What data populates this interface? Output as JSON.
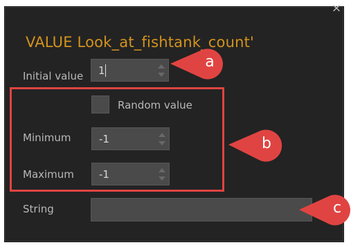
{
  "dialog": {
    "title": "VALUE Look_at_fishtank_count'",
    "close_glyph": "×"
  },
  "fields": {
    "initial_value_label": "Initial value",
    "initial_value": "1",
    "random_value_label": "Random value",
    "random_value_checked": false,
    "minimum_label": "Minimum",
    "minimum_value": "-1",
    "maximum_label": "Maximum",
    "maximum_value": "-1",
    "string_label": "String",
    "string_value": ""
  },
  "annotations": {
    "a": "a",
    "b": "b",
    "c": "c",
    "color": "#e04442"
  },
  "colors": {
    "title": "#d4931d",
    "panel": "#232323",
    "field": "#4a4a4a",
    "label": "#b8b8b8"
  }
}
